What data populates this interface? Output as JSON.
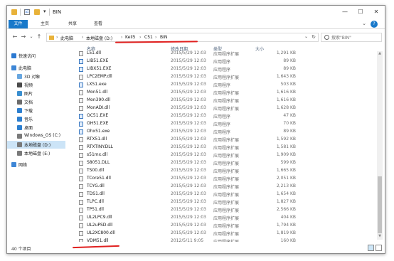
{
  "window": {
    "title": "BIN",
    "quick_access_check": "☑",
    "quick_access_dropdown": "▾",
    "minimize": "—",
    "maximize": "☐",
    "close": "✕"
  },
  "ribbon": {
    "tabs": [
      "文件",
      "主页",
      "共享",
      "查看"
    ],
    "expand": "⌄",
    "help": "?"
  },
  "nav": {
    "back": "←",
    "forward": "→",
    "up_history": "⌄",
    "up": "↑"
  },
  "address": {
    "crumbs": [
      "此电脑",
      "本地磁盘 (D:)",
      "Keil5",
      "C51",
      "BIN"
    ],
    "separator": "›",
    "dropdown": "⌄",
    "refresh": "↻"
  },
  "search": {
    "placeholder": "搜索\"BIN\""
  },
  "sidebar": {
    "items": [
      {
        "label": "快速访问",
        "icon": "star-icon",
        "color": "#2b79d1"
      },
      {
        "label": "此电脑",
        "icon": "computer-icon",
        "color": "#3d86d6"
      },
      {
        "label": "3D 对象",
        "icon": "cube-icon",
        "color": "#69a7e0"
      },
      {
        "label": "视频",
        "icon": "video-icon",
        "color": "#4a4a4a"
      },
      {
        "label": "图片",
        "icon": "picture-icon",
        "color": "#3a8fd0"
      },
      {
        "label": "文档",
        "icon": "document-icon",
        "color": "#6b6b6b"
      },
      {
        "label": "下载",
        "icon": "download-icon",
        "color": "#2d7fcf"
      },
      {
        "label": "音乐",
        "icon": "music-icon",
        "color": "#2d7fcf"
      },
      {
        "label": "桌面",
        "icon": "desktop-icon",
        "color": "#2d7fcf"
      },
      {
        "label": "Windows_OS (C:)",
        "icon": "drive-icon",
        "color": "#7a7a7a"
      },
      {
        "label": "本地磁盘 (D:)",
        "icon": "drive-icon",
        "color": "#7a7a7a"
      },
      {
        "label": "本地磁盘 (E:)",
        "icon": "drive-icon",
        "color": "#7a7a7a"
      },
      {
        "label": "网络",
        "icon": "network-icon",
        "color": "#3d86d6"
      }
    ]
  },
  "columns": {
    "name": "名称",
    "date": "修改日期",
    "type": "类型",
    "size": "大小",
    "sort_arrow": "^"
  },
  "files": [
    {
      "name": "L51.dll",
      "date": "2015/5/29 12:03",
      "type": "应用程序扩展",
      "size": "1,291 KB",
      "kind": "dll"
    },
    {
      "name": "LIB51.EXE",
      "date": "2015/5/29 12:03",
      "type": "应用程序",
      "size": "89 KB",
      "kind": "exe"
    },
    {
      "name": "LIBX51.EXE",
      "date": "2015/5/29 12:03",
      "type": "应用程序",
      "size": "89 KB",
      "kind": "exe"
    },
    {
      "name": "LPC2EMP.dll",
      "date": "2015/5/29 12:03",
      "type": "应用程序扩展",
      "size": "1,643 KB",
      "kind": "dll"
    },
    {
      "name": "LX51.exe",
      "date": "2015/5/29 12:03",
      "type": "应用程序",
      "size": "503 KB",
      "kind": "exe"
    },
    {
      "name": "Mon51.dll",
      "date": "2015/5/29 12:03",
      "type": "应用程序扩展",
      "size": "1,616 KB",
      "kind": "dll"
    },
    {
      "name": "Mon390.dll",
      "date": "2015/5/29 12:03",
      "type": "应用程序扩展",
      "size": "1,616 KB",
      "kind": "dll"
    },
    {
      "name": "MonADI.dll",
      "date": "2015/5/29 12:03",
      "type": "应用程序扩展",
      "size": "1,628 KB",
      "kind": "dll"
    },
    {
      "name": "OC51.EXE",
      "date": "2015/5/29 12:03",
      "type": "应用程序",
      "size": "47 KB",
      "kind": "exe"
    },
    {
      "name": "OH51.EXE",
      "date": "2015/5/29 12:03",
      "type": "应用程序",
      "size": "70 KB",
      "kind": "exe"
    },
    {
      "name": "Ohx51.exe",
      "date": "2015/5/29 12:03",
      "type": "应用程序",
      "size": "89 KB",
      "kind": "exe"
    },
    {
      "name": "RTX51.dll",
      "date": "2015/5/29 12:03",
      "type": "应用程序扩展",
      "size": "1,592 KB",
      "kind": "dll"
    },
    {
      "name": "RTXTINY.DLL",
      "date": "2015/5/29 12:03",
      "type": "应用程序扩展",
      "size": "1,581 KB",
      "kind": "dll"
    },
    {
      "name": "s51mx.dll",
      "date": "2015/5/29 12:03",
      "type": "应用程序扩展",
      "size": "1,909 KB",
      "kind": "dll"
    },
    {
      "name": "S8051.DLL",
      "date": "2015/5/29 12:03",
      "type": "应用程序扩展",
      "size": "599 KB",
      "kind": "dll"
    },
    {
      "name": "TS00.dll",
      "date": "2015/5/29 12:03",
      "type": "应用程序扩展",
      "size": "1,665 KB",
      "kind": "dll"
    },
    {
      "name": "TCore51.dll",
      "date": "2015/5/29 12:03",
      "type": "应用程序扩展",
      "size": "2,051 KB",
      "kind": "dll"
    },
    {
      "name": "TCYG.dll",
      "date": "2015/5/29 12:03",
      "type": "应用程序扩展",
      "size": "2,213 KB",
      "kind": "dll"
    },
    {
      "name": "TDS1.dll",
      "date": "2015/5/29 12:03",
      "type": "应用程序扩展",
      "size": "1,654 KB",
      "kind": "dll"
    },
    {
      "name": "TLPC.dll",
      "date": "2015/5/29 12:03",
      "type": "应用程序扩展",
      "size": "1,827 KB",
      "kind": "dll"
    },
    {
      "name": "TP51.dll",
      "date": "2015/5/29 12:03",
      "type": "应用程序扩展",
      "size": "2,566 KB",
      "kind": "dll"
    },
    {
      "name": "UL2LPC9.dll",
      "date": "2015/5/29 12:03",
      "type": "应用程序扩展",
      "size": "404 KB",
      "kind": "dll"
    },
    {
      "name": "UL2uPSD.dll",
      "date": "2015/5/29 12:03",
      "type": "应用程序扩展",
      "size": "1,794 KB",
      "kind": "dll"
    },
    {
      "name": "UL2XC800.dll",
      "date": "2015/5/29 12:03",
      "type": "应用程序扩展",
      "size": "1,819 KB",
      "kind": "dll"
    },
    {
      "name": "VDM51.dll",
      "date": "2012/5/11 9:05",
      "type": "应用程序扩展",
      "size": "160 KB",
      "kind": "dll"
    }
  ],
  "status": {
    "count": "40 个项目"
  },
  "colors": {
    "accent": "#1979ca",
    "annotation": "#e0201f",
    "selected": "#cce4f7"
  }
}
